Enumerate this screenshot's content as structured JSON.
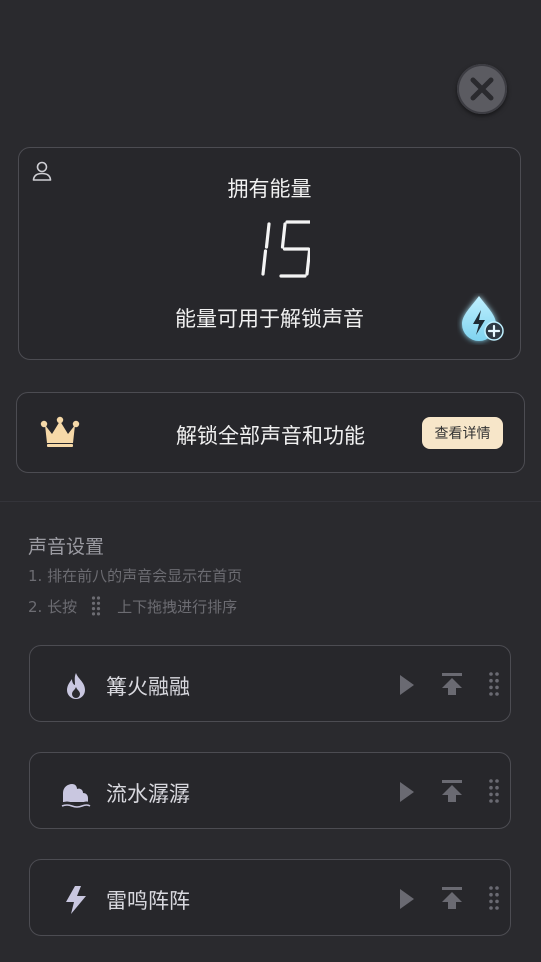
{
  "energy": {
    "title": "拥有能量",
    "value": "15",
    "description": "能量可用于解锁声音"
  },
  "premium": {
    "text": "解锁全部声音和功能",
    "details_button": "查看详情"
  },
  "settings": {
    "title": "声音设置",
    "hint1": "1. 排在前八的声音会显示在首页",
    "hint2_prefix": "2. 长按",
    "hint2_suffix": "上下拖拽进行排序"
  },
  "sounds": [
    {
      "name": "篝火融融",
      "icon": "fire-icon"
    },
    {
      "name": "流水潺潺",
      "icon": "water-icon"
    },
    {
      "name": "雷鸣阵阵",
      "icon": "lightning-icon"
    }
  ],
  "colors": {
    "background": "#2a2a2e",
    "card_border": "#4c4c52",
    "premium_button": "#f7e6c9",
    "crown": "#f6d9a8",
    "energy_drop": "#8fdcf4"
  }
}
